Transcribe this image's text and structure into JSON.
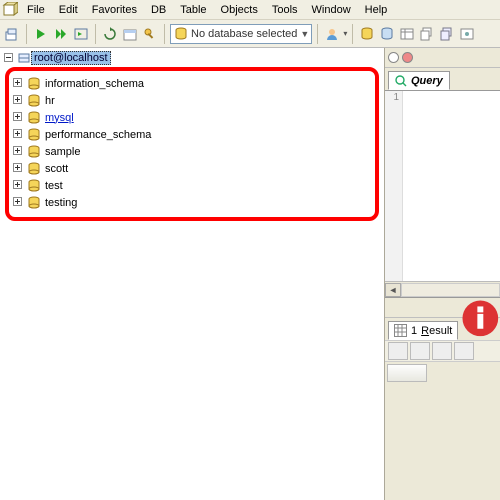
{
  "menu": {
    "items": [
      "File",
      "Edit",
      "Favorites",
      "DB",
      "Table",
      "Objects",
      "Tools",
      "Window",
      "Help"
    ]
  },
  "toolbar": {
    "db_selector": "No database selected"
  },
  "tree": {
    "root_label": "root@localhost",
    "databases": [
      {
        "name": "information_schema",
        "selected": false
      },
      {
        "name": "hr",
        "selected": false
      },
      {
        "name": "mysql",
        "selected": true
      },
      {
        "name": "performance_schema",
        "selected": false
      },
      {
        "name": "sample",
        "selected": false
      },
      {
        "name": "scott",
        "selected": false
      },
      {
        "name": "test",
        "selected": false
      },
      {
        "name": "testing",
        "selected": false
      }
    ]
  },
  "query_panel": {
    "tab_label": "Query",
    "gutter_first_line": "1"
  },
  "result_panel": {
    "tab_label_prefix": "1",
    "tab_label_text": "Result",
    "tab_label_underline": "R"
  }
}
